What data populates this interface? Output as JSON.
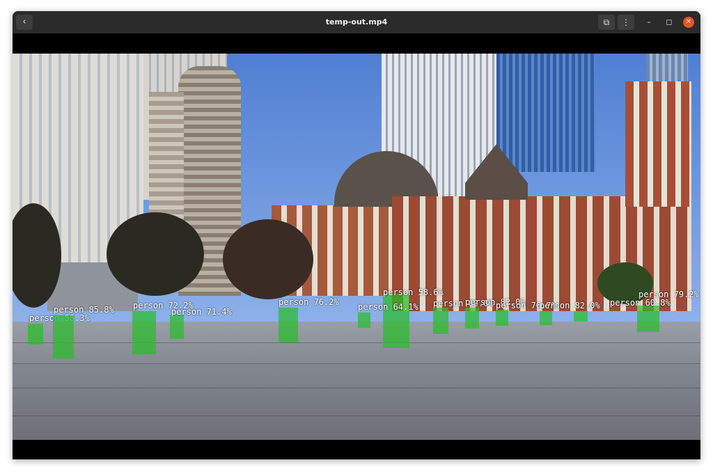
{
  "titlebar": {
    "title": "temp-out.mp4",
    "back_icon": "‹",
    "pip_icon": "⧉",
    "menu_icon": "⋮",
    "minimize_icon": "–",
    "maximize_icon": "◻",
    "close_icon": "✕"
  },
  "colors": {
    "titlebar": "#2b2b2b",
    "close": "#e95420",
    "detection": "#2fbf2f"
  },
  "detections": [
    {
      "label": "person 58.3%"
    },
    {
      "label": "person 85.8%"
    },
    {
      "label": "person 72.2%"
    },
    {
      "label": "person 71.4%"
    },
    {
      "label": "person 76.2%"
    },
    {
      "label": "person 58.6%"
    },
    {
      "label": "person 64.1%"
    },
    {
      "label": "person 62.0%"
    },
    {
      "label": "person 82.0%"
    },
    {
      "label": "person 76.7%"
    },
    {
      "label": "person 82.0%"
    },
    {
      "label": "person 60.8%"
    },
    {
      "label": "person 79.2%"
    }
  ]
}
